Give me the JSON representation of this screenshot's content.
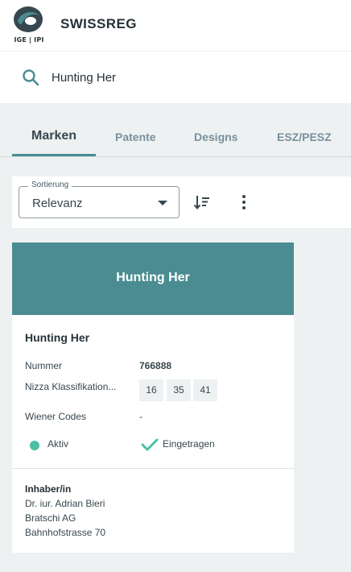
{
  "header": {
    "logo_caption": "IGE | IPI",
    "app_title": "SWISSREG",
    "brand_color": "#4a8c92"
  },
  "search": {
    "value": "Hunting Her",
    "icon": "search-icon"
  },
  "tabs": [
    {
      "label": "Marken",
      "active": true
    },
    {
      "label": "Patente",
      "active": false
    },
    {
      "label": "Designs",
      "active": false
    },
    {
      "label": "ESZ/PESZ",
      "active": false
    }
  ],
  "toolbar": {
    "sort_label": "Sortierung",
    "sort_value": "Relevanz",
    "sort_order_icon": "sort-descending-icon",
    "more_icon": "more-vertical-icon"
  },
  "result": {
    "banner_title": "Hunting Her",
    "title": "Hunting Her",
    "fields": {
      "number_label": "Nummer",
      "number_value": "766888",
      "nice_label": "Nizza Klassifikation...",
      "nice_classes": [
        "16",
        "35",
        "41"
      ],
      "vienna_label": "Wiener Codes",
      "vienna_value": "-"
    },
    "status": {
      "state": "Aktiv",
      "state_color": "#4bbfa6",
      "registration": "Eingetragen"
    },
    "owner": {
      "heading": "Inhaber/in",
      "lines": [
        "Dr. iur. Adrian Bieri",
        "Bratschi AG",
        "Bahnhofstrasse 70"
      ]
    }
  }
}
